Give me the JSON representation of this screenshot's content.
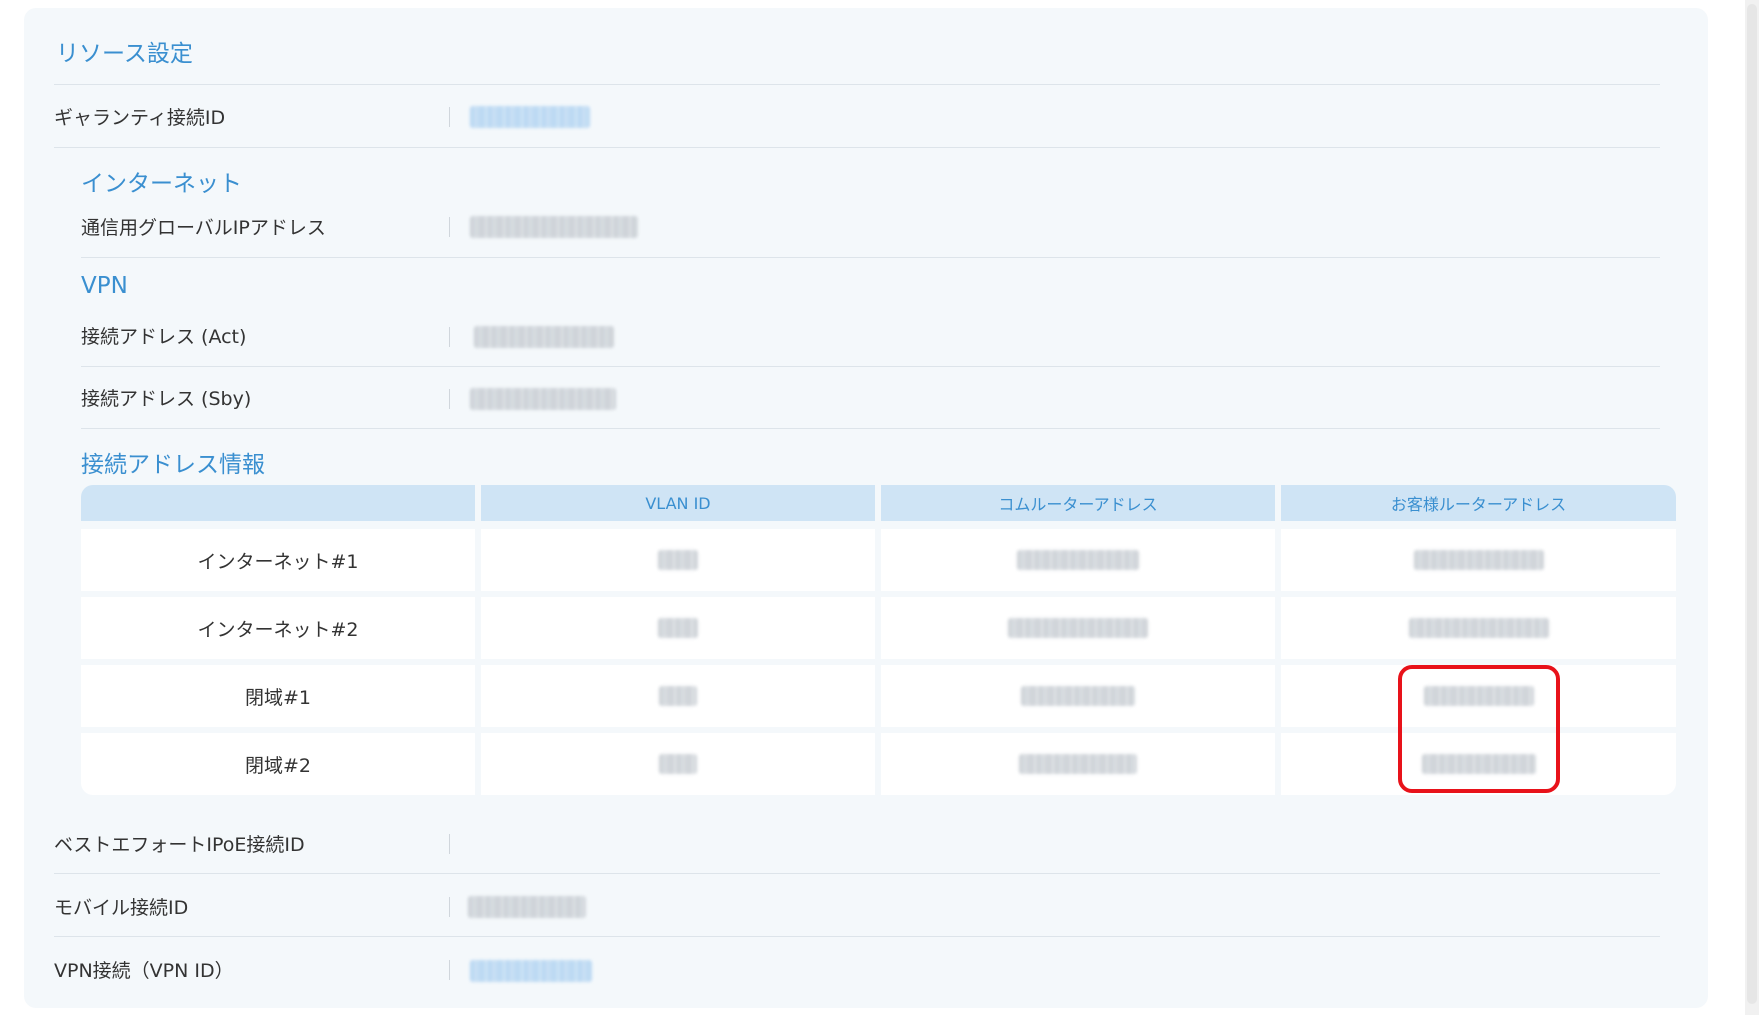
{
  "section_title": "リソース設定",
  "guarantee_id": {
    "label": "ギャランティ接続ID"
  },
  "internet": {
    "title": "インターネット",
    "global_ip_label": "通信用グローバルIPアドレス"
  },
  "vpn": {
    "title": "VPN",
    "act_label": "接続アドレス (Act)",
    "sby_label": "接続アドレス (Sby)"
  },
  "address_info": {
    "title": "接続アドレス情報",
    "columns": [
      "",
      "VLAN ID",
      "コムルーターアドレス",
      "お客様ルーターアドレス"
    ],
    "rows": [
      {
        "name": "インターネット#1"
      },
      {
        "name": "インターネット#2"
      },
      {
        "name": "閉域#1"
      },
      {
        "name": "閉域#2"
      }
    ]
  },
  "best_effort": {
    "label": "ベストエフォートIPoE接続ID"
  },
  "mobile": {
    "label": "モバイル接続ID"
  },
  "vpn_connection": {
    "label": "VPN接続（VPN ID）"
  },
  "colors": {
    "accent": "#3a8fd0",
    "header_bg": "#cfe4f5",
    "card_bg": "#f4f8fb",
    "highlight": "#e8121a"
  }
}
